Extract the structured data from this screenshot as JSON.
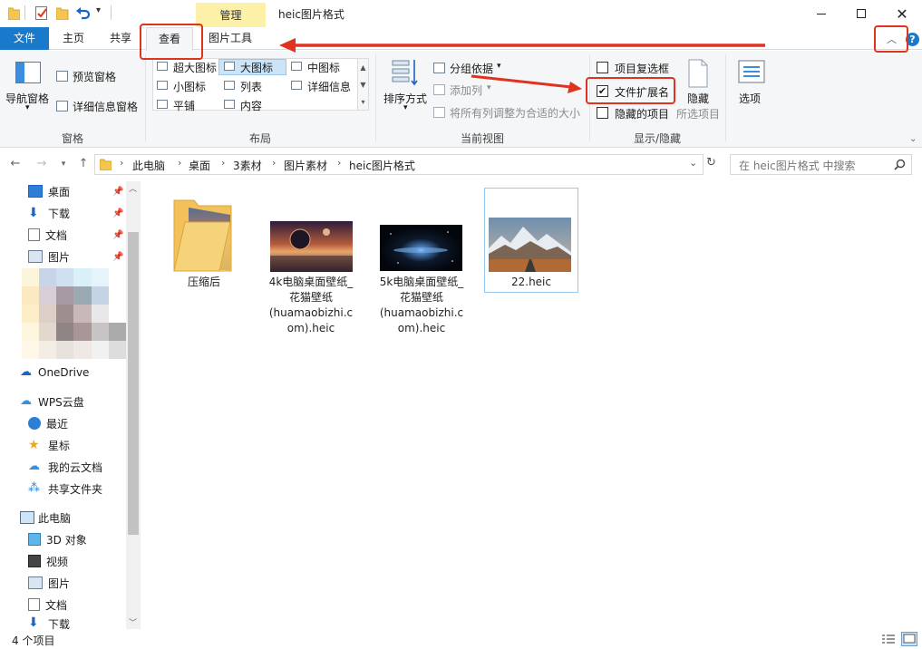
{
  "window": {
    "title": "heic图片格式",
    "context_tab_group": "管理"
  },
  "tabs": [
    {
      "label": "文件",
      "active": false,
      "primary": true
    },
    {
      "label": "主页",
      "active": false
    },
    {
      "label": "共享",
      "active": false
    },
    {
      "label": "查看",
      "active": true
    },
    {
      "label": "图片工具",
      "active": false
    }
  ],
  "ribbon": {
    "pane_group": {
      "label": "窗格",
      "nav_pane": "导航窗格",
      "preview_pane": "预览窗格",
      "details_pane": "详细信息窗格"
    },
    "layout_group": {
      "label": "布局",
      "options": [
        {
          "label": "超大图标",
          "selected": false
        },
        {
          "label": "大图标",
          "selected": true
        },
        {
          "label": "中图标",
          "selected": false
        },
        {
          "label": "小图标",
          "selected": false
        },
        {
          "label": "列表",
          "selected": false
        },
        {
          "label": "详细信息",
          "selected": false
        },
        {
          "label": "平铺",
          "selected": false
        },
        {
          "label": "内容",
          "selected": false
        }
      ]
    },
    "view_group": {
      "label": "当前视图",
      "sort_by": "排序方式",
      "group_by": "分组依据",
      "add_column": "添加列",
      "fit_columns": "将所有列调整为合适的大小"
    },
    "show_hide_group": {
      "label": "显示/隐藏",
      "item_checkboxes": {
        "label": "项目复选框",
        "checked": false
      },
      "file_extensions": {
        "label": "文件扩展名",
        "checked": true
      },
      "hidden_items": {
        "label": "隐藏的项目",
        "checked": false
      },
      "hide_selected": "隐藏",
      "hide_selected_sub": "所选项目"
    },
    "options": "选项"
  },
  "address": {
    "crumbs": [
      "此电脑",
      "桌面",
      "3素材",
      "图片素材",
      "heic图片格式"
    ],
    "search_placeholder": "在 heic图片格式 中搜索"
  },
  "nav": {
    "quick_access": [
      {
        "label": "桌面",
        "pinned": true
      },
      {
        "label": "下载",
        "pinned": true
      },
      {
        "label": "文档",
        "pinned": true
      },
      {
        "label": "图片",
        "pinned": true
      }
    ],
    "onedrive": "OneDrive",
    "wps": "WPS云盘",
    "wps_items": [
      "最近",
      "星标",
      "我的云文档",
      "共享文件夹"
    ],
    "this_pc": "此电脑",
    "pc_items": [
      "3D 对象",
      "视频",
      "图片",
      "文档",
      "下载"
    ]
  },
  "files": [
    {
      "name_lines": [
        "压缩后"
      ],
      "kind": "folder"
    },
    {
      "name_lines": [
        "4k电脑桌面壁纸_",
        "花猫壁纸",
        "(huamaobizhi.c",
        "om).heic"
      ],
      "kind": "image"
    },
    {
      "name_lines": [
        "5k电脑桌面壁纸_",
        "花猫壁纸",
        "(huamaobizhi.c",
        "om).heic"
      ],
      "kind": "image"
    },
    {
      "name_lines": [
        "22.heic"
      ],
      "kind": "image",
      "selected": true
    }
  ],
  "status": {
    "item_count": "4 个项目"
  },
  "colors": {
    "accent": "#1979ca",
    "annotation": "#e0331f",
    "context_tab": "#fdf0a8"
  }
}
